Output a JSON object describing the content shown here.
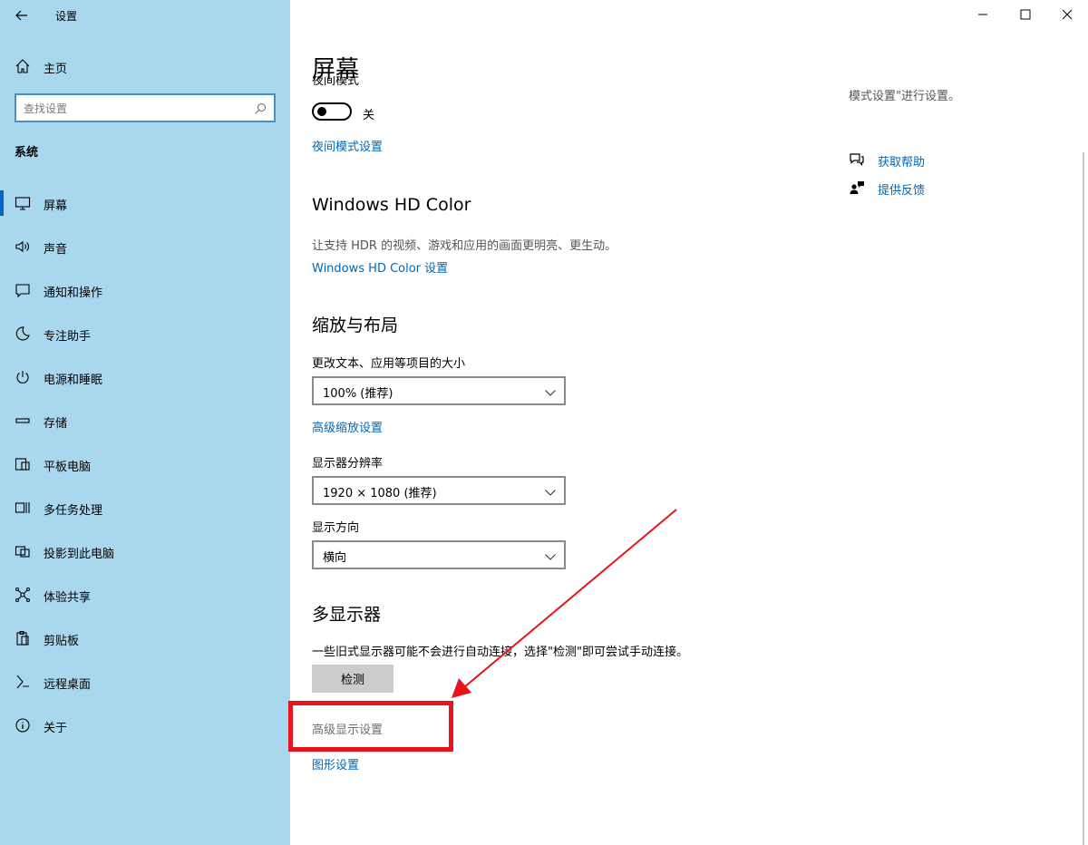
{
  "window": {
    "app_title": "设置"
  },
  "sidebar": {
    "home_label": "主页",
    "search_placeholder": "查找设置",
    "group_header": "系统",
    "items": [
      {
        "label": "屏幕",
        "icon": "monitor-icon",
        "active": true
      },
      {
        "label": "声音",
        "icon": "speaker-icon"
      },
      {
        "label": "通知和操作",
        "icon": "notification-icon"
      },
      {
        "label": "专注助手",
        "icon": "moon-icon"
      },
      {
        "label": "电源和睡眠",
        "icon": "power-icon"
      },
      {
        "label": "存储",
        "icon": "storage-icon"
      },
      {
        "label": "平板电脑",
        "icon": "tablet-icon"
      },
      {
        "label": "多任务处理",
        "icon": "multitask-icon"
      },
      {
        "label": "投影到此电脑",
        "icon": "project-icon"
      },
      {
        "label": "体验共享",
        "icon": "share-icon"
      },
      {
        "label": "剪贴板",
        "icon": "clipboard-icon"
      },
      {
        "label": "远程桌面",
        "icon": "remote-desktop-icon"
      },
      {
        "label": "关于",
        "icon": "info-icon"
      }
    ]
  },
  "main": {
    "page_title": "屏幕",
    "night_light_label": "夜间模式",
    "night_light_state": "关",
    "night_light_settings_link": "夜间模式设置",
    "hd_color": {
      "title": "Windows HD Color",
      "description": "让支持 HDR 的视频、游戏和应用的画面更明亮、更生动。",
      "link": "Windows HD Color 设置"
    },
    "scale_layout": {
      "title": "缩放与布局",
      "scale_label": "更改文本、应用等项目的大小",
      "scale_value": "100% (推荐)",
      "advanced_scaling_link": "高级缩放设置",
      "resolution_label": "显示器分辨率",
      "resolution_value": "1920 × 1080 (推荐)",
      "orientation_label": "显示方向",
      "orientation_value": "横向"
    },
    "multi_display": {
      "title": "多显示器",
      "description": "一些旧式显示器可能不会进行自动连接，选择\"检测\"即可尝试手动连接。",
      "detect_button": "检测",
      "advanced_display_link": "高级显示设置",
      "graphics_link": "图形设置"
    }
  },
  "right_panel": {
    "clipped_text": "模式设置\"进行设置。",
    "get_help": "获取帮助",
    "give_feedback": "提供反馈"
  },
  "colors": {
    "sidebar_bg": "#a8d7ee",
    "accent": "#0067b8",
    "annotation": "#e8141c"
  }
}
